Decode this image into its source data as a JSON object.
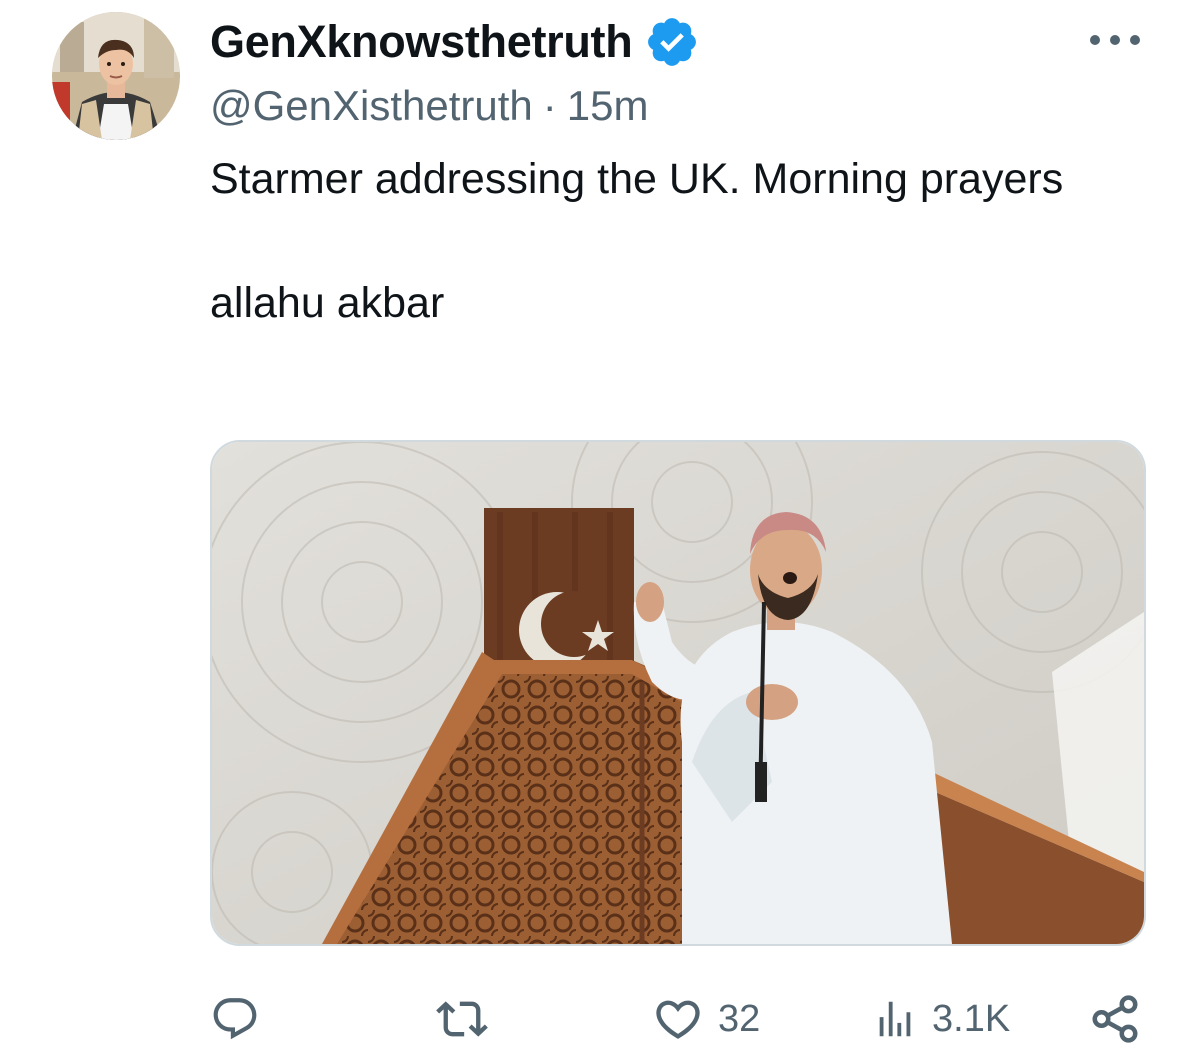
{
  "author": {
    "display_name": "GenXknowsthetruth",
    "handle": "@GenXisthetruth",
    "separator": "·",
    "time": "15m",
    "verified_color": "#1d9bf0"
  },
  "tweet": {
    "line1": "Starmer addressing the UK.  Morning prayers",
    "line2": "allahu akbar"
  },
  "media": {
    "subject": "man-speaking-at-wooden-pulpit-with-crescent-and-star"
  },
  "actions": {
    "reply": {
      "icon": "reply-icon",
      "count": ""
    },
    "repost": {
      "icon": "repost-icon",
      "count": ""
    },
    "like": {
      "icon": "heart-icon",
      "count": "32"
    },
    "views": {
      "icon": "views-icon",
      "count": "3.1K"
    },
    "share": {
      "icon": "share-icon"
    }
  },
  "colors": {
    "text": "#0f1419",
    "secondary": "#536471",
    "accent": "#1d9bf0",
    "border": "#cfd9de"
  }
}
